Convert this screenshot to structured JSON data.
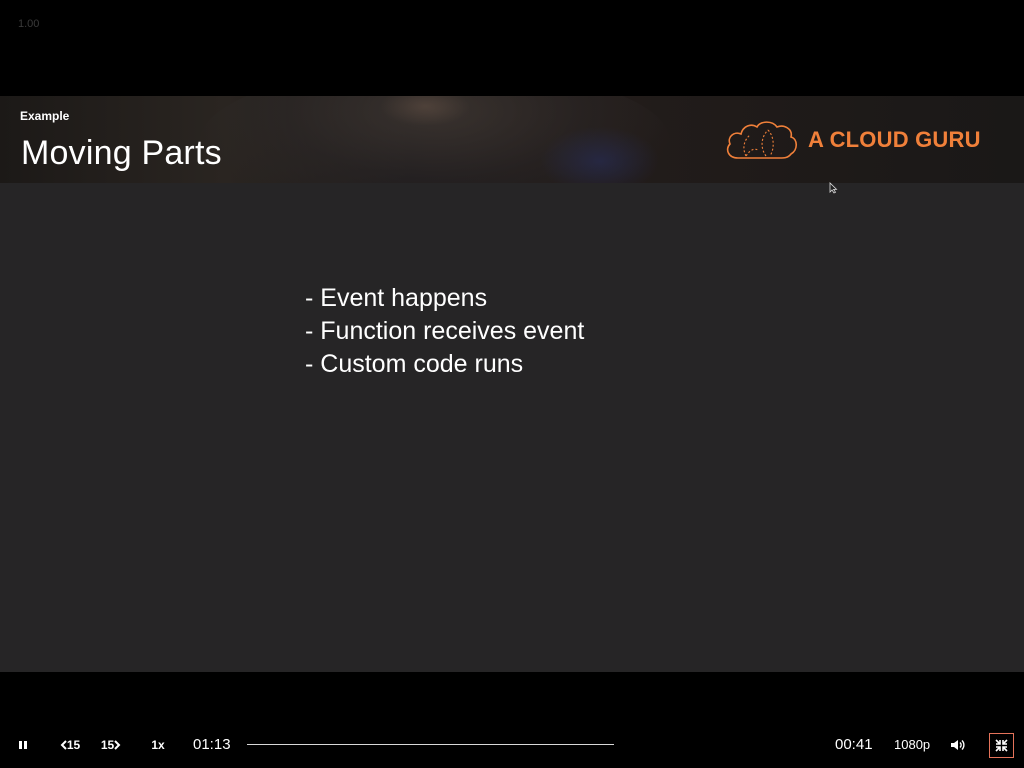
{
  "zoom_readout": "1.00",
  "slide": {
    "eyebrow": "Example",
    "title": "Moving Parts",
    "brand": "A CLOUD GURU",
    "bullets": [
      "- Event happens",
      "- Function receives event",
      "- Custom code runs"
    ]
  },
  "player": {
    "rewind_label": "15",
    "forward_label": "15",
    "speed_label": "1x",
    "elapsed_time": "01:13",
    "remaining_time": "00:41",
    "quality_label": "1080p",
    "icons": {
      "play_pause": "pause-icon",
      "rewind": "rewind-15-icon",
      "forward": "forward-15-icon",
      "volume": "volume-icon",
      "fullscreen": "exit-fullscreen-icon"
    }
  },
  "colors": {
    "brand_orange": "#f0803a",
    "slide_background": "#262526",
    "exit_fullscreen_border": "#e5735a"
  }
}
